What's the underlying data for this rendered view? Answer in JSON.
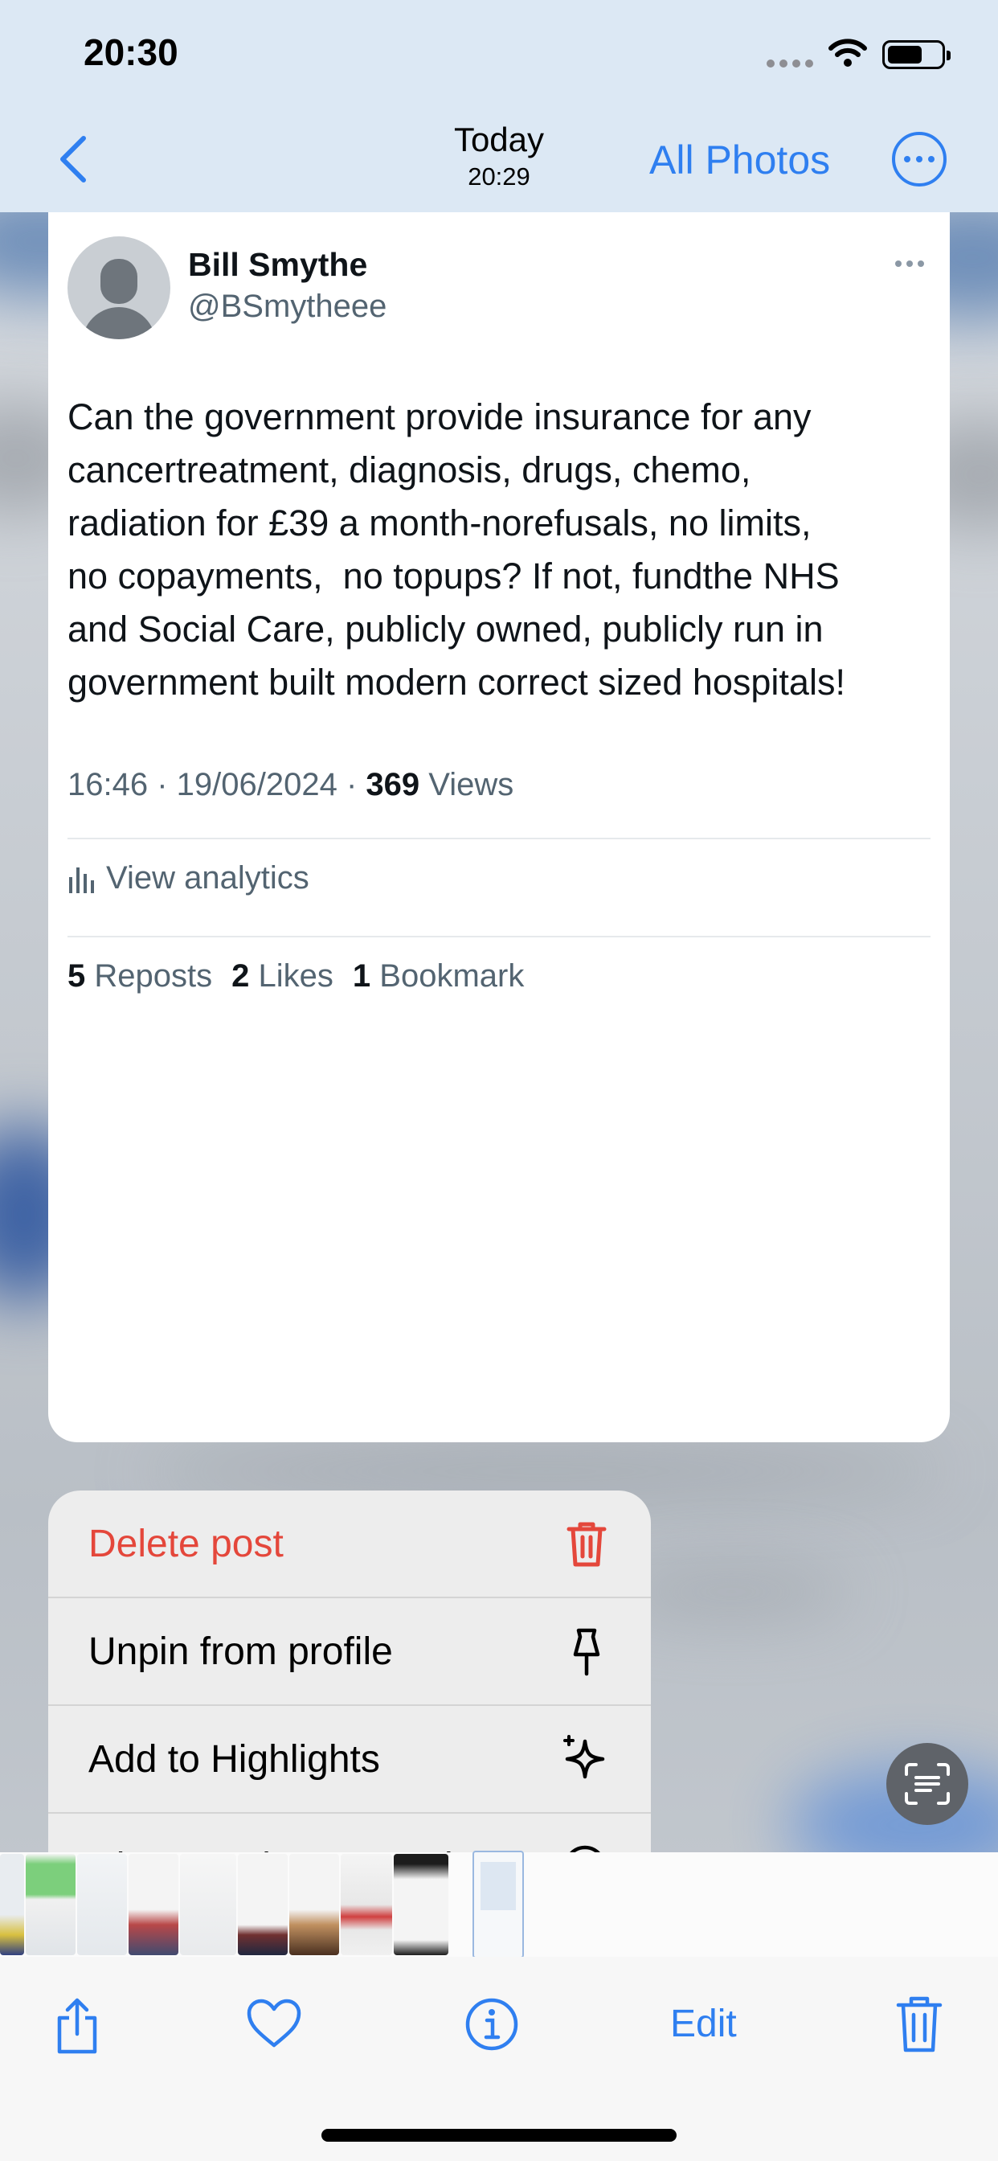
{
  "status_bar": {
    "time": "20:30"
  },
  "nav": {
    "title": "Today",
    "subtitle": "20:29",
    "all_photos": "All Photos"
  },
  "tweet": {
    "author_name": "Bill Smythe",
    "author_handle": "@BSmytheee",
    "text_lines": [
      "Can the government provide insurance for any",
      "cancertreatment, diagnosis, drugs, chemo,",
      "radiation for £39 a month-norefusals, no limits,",
      "no copayments,  no topups? If not, fundthe NHS",
      "and Social Care, publicly owned, publicly run in",
      "government built modern correct sized hospitals!"
    ],
    "timestamp": "16:46 · 19/06/2024 · ",
    "views_count": "369",
    "views_label": " Views",
    "analytics_label": "View analytics",
    "reposts_count": "5",
    "reposts_label": "Reposts",
    "likes_count": "2",
    "likes_label": "Likes",
    "bookmarks_count": "1",
    "bookmarks_label": "Bookmark"
  },
  "menu": {
    "items": [
      {
        "label": "Delete post",
        "icon": "trash-icon",
        "color": "#e4473b"
      },
      {
        "label": "Unpin from profile",
        "icon": "pin-icon"
      },
      {
        "label": "Add to Highlights",
        "icon": "sparkle-icon"
      },
      {
        "label": "Change who can reply",
        "icon": "reply-icon"
      }
    ]
  },
  "toolbar": {
    "edit_label": "Edit"
  },
  "colors": {
    "accent": "#2f7ff0",
    "danger": "#e4473b"
  }
}
